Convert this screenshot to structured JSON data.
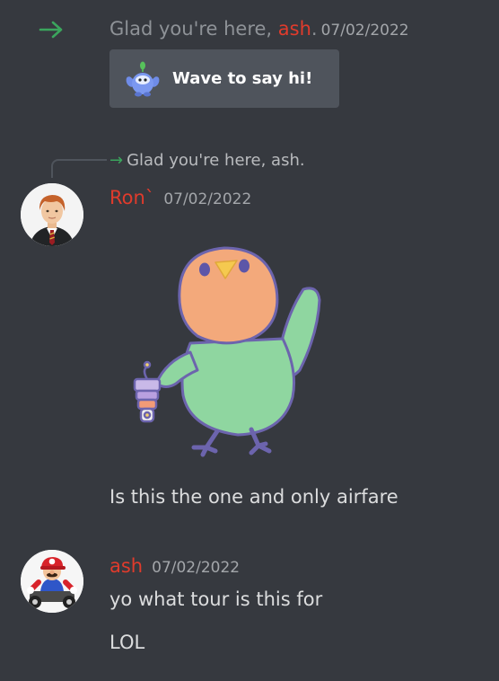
{
  "join_message": {
    "prefix": "Glad you're here, ",
    "username": "ash",
    "suffix": ".",
    "timestamp": "07/02/2022",
    "arrow_icon": "join-arrow-icon",
    "wave_button_label": "Wave to say hi!"
  },
  "messages": [
    {
      "author": "Ron`",
      "timestamp": "07/02/2022",
      "reply_to": {
        "arrow": "→",
        "text": "Glad you're here, ash."
      },
      "sticker": "parrot-sticker",
      "text": "Is this the one and only airfare"
    },
    {
      "author": "ash",
      "timestamp": "07/02/2022",
      "lines": [
        "yo what tour is this for",
        "LOL"
      ]
    }
  ],
  "colors": {
    "background": "#36393f",
    "username": "#e03b2c",
    "join_arrow": "#3ba55d",
    "wave_button": "#4f545c"
  }
}
